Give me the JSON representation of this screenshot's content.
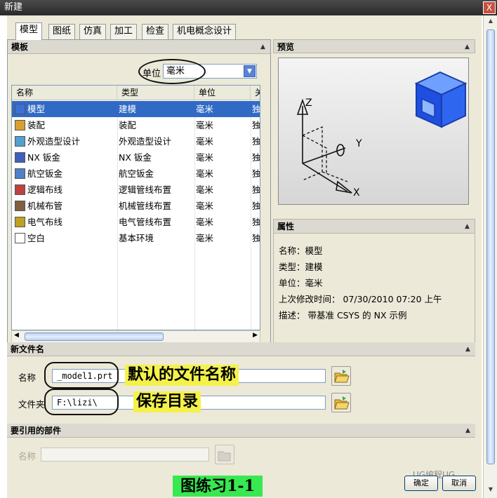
{
  "window": {
    "title": "新建",
    "close_glyph": "X"
  },
  "tabs": [
    "模型",
    "图纸",
    "仿真",
    "加工",
    "检查",
    "机电概念设计"
  ],
  "templates": {
    "header": "模板",
    "unit_label": "单位",
    "unit_value": "毫米",
    "columns": [
      "名称",
      "类型",
      "单位",
      "关"
    ],
    "rows": [
      {
        "name": "模型",
        "type": "建模",
        "unit": "毫米",
        "rel": "独",
        "selected": true,
        "icon": "model-icon"
      },
      {
        "name": "装配",
        "type": "装配",
        "unit": "毫米",
        "rel": "独",
        "icon": "assembly-icon"
      },
      {
        "name": "外观造型设计",
        "type": "外观造型设计",
        "unit": "毫米",
        "rel": "独",
        "icon": "shape-studio-icon"
      },
      {
        "name": "NX 钣金",
        "type": "NX 钣金",
        "unit": "毫米",
        "rel": "独",
        "icon": "sheet-metal-icon"
      },
      {
        "name": "航空钣金",
        "type": "航空钣金",
        "unit": "毫米",
        "rel": "独",
        "icon": "aero-sheet-metal-icon"
      },
      {
        "name": "逻辑布线",
        "type": "逻辑管线布置",
        "unit": "毫米",
        "rel": "独",
        "icon": "logical-routing-icon"
      },
      {
        "name": "机械布管",
        "type": "机械管线布置",
        "unit": "毫米",
        "rel": "独",
        "icon": "mechanical-routing-icon"
      },
      {
        "name": "电气布线",
        "type": "电气管线布置",
        "unit": "毫米",
        "rel": "独",
        "icon": "electrical-routing-icon"
      },
      {
        "name": "空白",
        "type": "基本环境",
        "unit": "毫米",
        "rel": "独",
        "icon": "blank-file-icon"
      }
    ]
  },
  "preview": {
    "header": "预览",
    "axes": {
      "z": "Z",
      "y": "Y",
      "x": "X"
    }
  },
  "properties": {
    "header": "属性",
    "items": [
      "名称：模型",
      "类型：建模",
      "单位：毫米",
      "上次修改时间： 07/30/2010 07:20 上午",
      "描述： 带基准 CSYS 的 NX 示例"
    ]
  },
  "new_file": {
    "header": "新文件名",
    "name_label": "名称",
    "name_value": "_model1.prt",
    "folder_label": "文件夹",
    "folder_value": "F:\\lizi\\",
    "annotation_name": "默认的文件名称",
    "annotation_folder": "保存目录"
  },
  "referenced": {
    "header": "要引用的部件",
    "name_label": "名称"
  },
  "buttons": {
    "ok": "确定",
    "cancel": "取消"
  },
  "caption": "图练习1-1",
  "watermark": "UG编程UG",
  "colors": {
    "selection": "#316ac5",
    "annotation": "#f4f24a",
    "caption": "#38e850"
  }
}
